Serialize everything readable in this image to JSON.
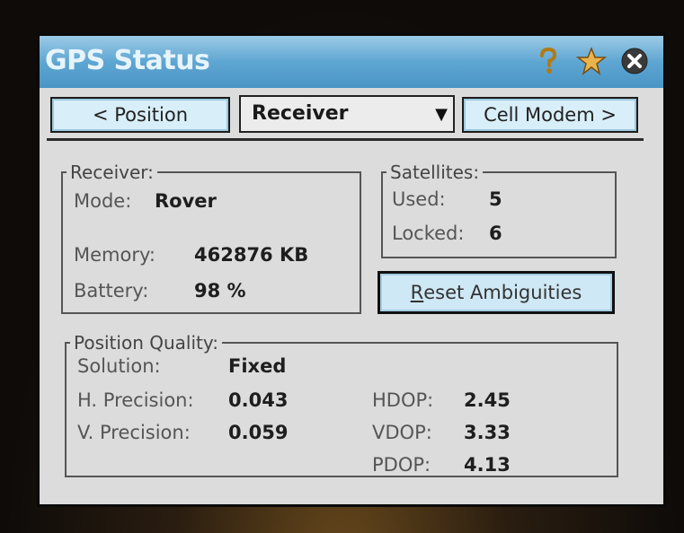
{
  "window": {
    "title": "GPS Status",
    "help_icon": "question-mark-icon",
    "pin_icon": "star-pin-icon",
    "close_icon": "close-icon"
  },
  "nav": {
    "prev_label": "< Position",
    "dropdown_value": "Receiver",
    "next_label": "Cell Modem >"
  },
  "receiver": {
    "legend": "Receiver:",
    "mode_label": "Mode:",
    "mode_value": "Rover",
    "memory_label": "Memory:",
    "memory_value": "462876 KB",
    "battery_label": "Battery:",
    "battery_value": "98 %"
  },
  "satellites": {
    "legend": "Satellites:",
    "used_label": "Used:",
    "used_value": "5",
    "locked_label": "Locked:",
    "locked_value": "6"
  },
  "reset_button": {
    "accel": "R",
    "rest": "eset Ambiguities"
  },
  "quality": {
    "legend": "Position Quality:",
    "solution_label": "Solution:",
    "solution_value": "Fixed",
    "hprec_label": "H. Precision:",
    "hprec_value": "0.043",
    "vprec_label": "V. Precision:",
    "vprec_value": "0.059",
    "hdop_label": "HDOP:",
    "hdop_value": "2.45",
    "vdop_label": "VDOP:",
    "vdop_value": "3.33",
    "pdop_label": "PDOP:",
    "pdop_value": "4.13"
  }
}
